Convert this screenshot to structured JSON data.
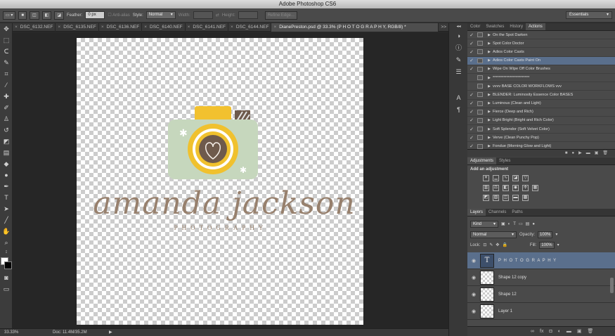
{
  "window": {
    "title": "Adobe Photoshop CS6"
  },
  "options": {
    "feather_label": "Feather:",
    "feather_value": "0 px",
    "antialias_label": "Anti-alias",
    "style_label": "Style:",
    "style_value": "Normal",
    "width_label": "Width:",
    "height_label": "Height:",
    "refine_edge": "Refine Edge...",
    "workspace": "Essentials"
  },
  "tabs": [
    {
      "label": "DSC_6132.NEF"
    },
    {
      "label": "DSC_6135.NEF"
    },
    {
      "label": "DSC_6136.NEF"
    },
    {
      "label": "DSC_6140.NEF"
    },
    {
      "label": "DSC_6141.NEF"
    },
    {
      "label": "DSC_6144.NEF"
    },
    {
      "label": "DianePreston.psd @ 33.3% (P H O T O G R A P H Y, RGB/8) *"
    }
  ],
  "tabs_overflow": ">>",
  "canvas": {
    "brand_text": "amanda jackson",
    "tagline_text": "PHOTOGRAPHY"
  },
  "status": {
    "zoom": "33.33%",
    "doc": "Doc: 11.4M/35.2M"
  },
  "actions_panel": {
    "tabs": [
      {
        "label": "Color"
      },
      {
        "label": "Swatches"
      },
      {
        "label": "History"
      },
      {
        "label": "Actions"
      }
    ],
    "rows": [
      {
        "label": "On the Spot Darken"
      },
      {
        "label": "Spot Color Doctor"
      },
      {
        "label": "Adios Color Casts"
      },
      {
        "label": "Adios Color Casts Paint On"
      },
      {
        "label": "Wipe On Wipe Off Color Brushes"
      },
      {
        "label": "************************"
      },
      {
        "label": "vvvv   BASE COLOR WORKFLOWS  vvv"
      },
      {
        "label": "BLENDER: Luminosity Essence Color BASES"
      },
      {
        "label": "Luminous (Clean and Light)"
      },
      {
        "label": "Fierce (Deep and Rich)"
      },
      {
        "label": "Light Bright (Bright and Rich Color)"
      },
      {
        "label": "Soft Splendor (Soft Velvet Color)"
      },
      {
        "label": "Verve (Clean Punchy Pop)"
      },
      {
        "label": "Fondue (Morning Glow and Light)"
      }
    ]
  },
  "adjustments_panel": {
    "tabs": [
      {
        "label": "Adjustments"
      },
      {
        "label": "Styles"
      }
    ],
    "title": "Add an adjustment"
  },
  "layers_panel": {
    "tabs": [
      {
        "label": "Layers"
      },
      {
        "label": "Channels"
      },
      {
        "label": "Paths"
      }
    ],
    "kind": "Kind",
    "blend_mode": "Normal",
    "opacity_label": "Opacity:",
    "opacity_value": "100%",
    "lock_label": "Lock:",
    "fill_label": "Fill:",
    "fill_value": "100%",
    "layers": [
      {
        "name": "P H O T O G R A P H Y"
      },
      {
        "name": "Shape 12 copy"
      },
      {
        "name": "Shape 12"
      },
      {
        "name": "Layer 1"
      }
    ]
  },
  "colors": {
    "camera_body": "#c6d7bd",
    "camera_top": "#f2c12f",
    "lens_ring": "#f0c12e",
    "brand_text": "#97806d",
    "selection": "#5a6f8c"
  }
}
